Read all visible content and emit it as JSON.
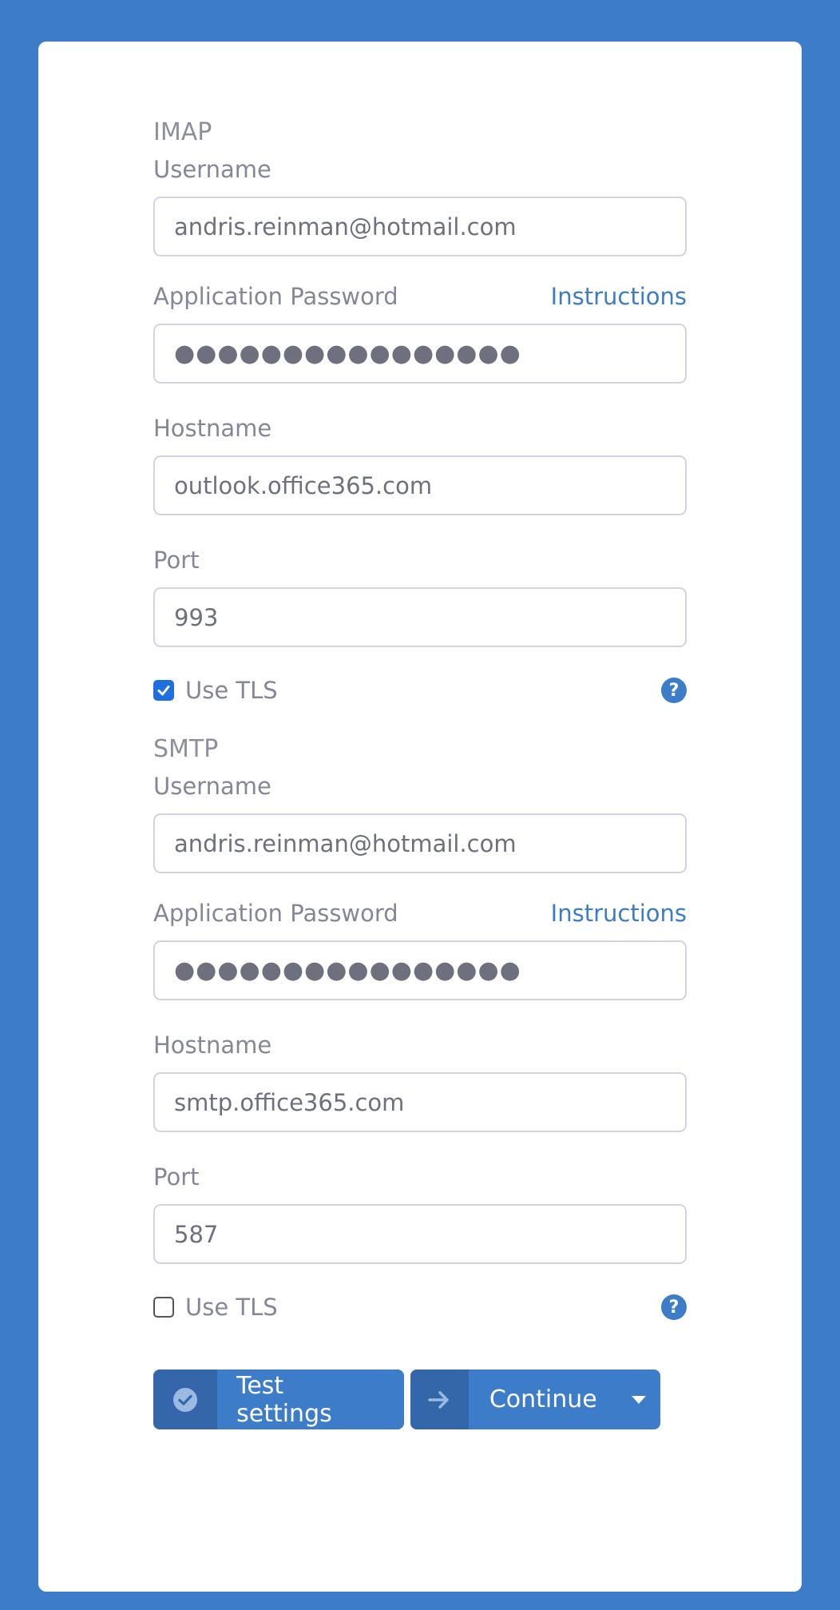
{
  "imap": {
    "section_title": "IMAP",
    "username_label": "Username",
    "username_value": "andris.reinman@hotmail.com",
    "password_label": "Application Password",
    "instructions_link": "Instructions",
    "password_value": "●●●●●●●●●●●●●●●●",
    "hostname_label": "Hostname",
    "hostname_value": "outlook.office365.com",
    "port_label": "Port",
    "port_value": "993",
    "tls_label": "Use TLS",
    "tls_checked": true
  },
  "smtp": {
    "section_title": "SMTP",
    "username_label": "Username",
    "username_value": "andris.reinman@hotmail.com",
    "password_label": "Application Password",
    "instructions_link": "Instructions",
    "password_value": "●●●●●●●●●●●●●●●●",
    "hostname_label": "Hostname",
    "hostname_value": "smtp.office365.com",
    "port_label": "Port",
    "port_value": "587",
    "tls_label": "Use TLS",
    "tls_checked": false
  },
  "buttons": {
    "test_label": "Test settings",
    "test_icon": "check-circle-icon",
    "continue_label": "Continue",
    "continue_icon": "arrow-right-icon",
    "dropdown_icon": "caret-down-icon"
  },
  "colors": {
    "background": "#3d7cc9",
    "accent": "#3d7cc9",
    "button_icon_bg": "#3367aa"
  }
}
